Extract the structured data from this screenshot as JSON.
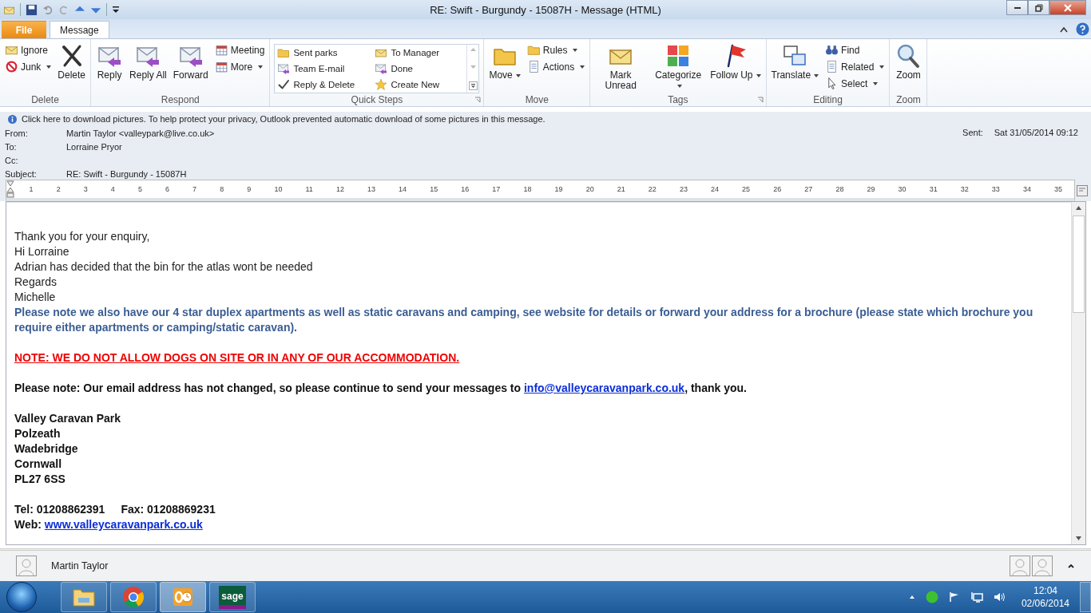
{
  "window": {
    "title": "RE: Swift - Burgundy - 15087H  -  Message (HTML)"
  },
  "tabs": [
    {
      "label": "File",
      "kind": "file",
      "selected": false
    },
    {
      "label": "Message",
      "kind": "tab",
      "selected": true
    }
  ],
  "ribbon": {
    "groups": [
      {
        "label": "Delete",
        "items": [
          {
            "kind": "column",
            "buttons": [
              {
                "label": "Ignore",
                "dropdown": false
              },
              {
                "label": "Junk",
                "dropdown": true
              }
            ]
          },
          {
            "kind": "large",
            "label": "Delete",
            "dropdown": false
          }
        ]
      },
      {
        "label": "Respond",
        "items": [
          {
            "kind": "large",
            "label": "Reply",
            "dropdown": false
          },
          {
            "kind": "large",
            "label": "Reply All",
            "dropdown": false
          },
          {
            "kind": "large",
            "label": "Forward",
            "dropdown": false
          },
          {
            "kind": "column",
            "buttons": [
              {
                "label": "Meeting",
                "dropdown": false
              },
              {
                "label": "More",
                "dropdown": true
              }
            ]
          }
        ]
      },
      {
        "label": "Quick Steps",
        "launcher": true,
        "items": [
          {
            "kind": "gallery",
            "buttons": [
              {
                "label": "Sent parks"
              },
              {
                "label": "To Manager"
              },
              {
                "label": "Team E-mail"
              },
              {
                "label": "Done"
              },
              {
                "label": "Reply & Delete"
              },
              {
                "label": "Create New"
              }
            ]
          }
        ]
      },
      {
        "label": "Move",
        "items": [
          {
            "kind": "large",
            "label": "Move",
            "dropdown": true
          },
          {
            "kind": "column",
            "buttons": [
              {
                "label": "Rules",
                "dropdown": true
              },
              {
                "label": "Actions",
                "dropdown": true
              }
            ]
          }
        ]
      },
      {
        "label": "Tags",
        "launcher": true,
        "items": [
          {
            "kind": "large",
            "label": "Mark Unread",
            "dropdown": false
          },
          {
            "kind": "large",
            "label": "Categorize",
            "dropdown": true
          },
          {
            "kind": "large",
            "label": "Follow Up",
            "dropdown": true
          }
        ]
      },
      {
        "label": "Editing",
        "items": [
          {
            "kind": "large",
            "label": "Translate",
            "dropdown": true
          },
          {
            "kind": "column",
            "buttons": [
              {
                "label": "Find",
                "dropdown": false
              },
              {
                "label": "Related",
                "dropdown": true
              },
              {
                "label": "Select",
                "dropdown": true
              }
            ]
          }
        ]
      },
      {
        "label": "Zoom",
        "items": [
          {
            "kind": "large",
            "label": "Zoom",
            "dropdown": false
          }
        ]
      }
    ]
  },
  "info_bar": {
    "text": "Click here to download pictures. To help protect your privacy, Outlook prevented automatic download of some pictures in this message."
  },
  "header": {
    "fields": [
      {
        "label": "From:",
        "value": "Martin Taylor <valleypark@live.co.uk>"
      },
      {
        "label": "To:",
        "value": "Lorraine Pryor"
      },
      {
        "label": "Cc:"
      },
      {
        "label": "Subject:",
        "value": "RE: Swift - Burgundy - 15087H"
      }
    ],
    "sent": {
      "label": "Sent:",
      "value": "Sat 31/05/2014 09:12"
    }
  },
  "ruler": {
    "marks": [
      "1",
      "2",
      "3",
      "4",
      "5",
      "6",
      "7",
      "8",
      "9",
      "10",
      "11",
      "12",
      "13",
      "14",
      "15",
      "16",
      "17",
      "18",
      "19",
      "20",
      "21",
      "22",
      "23",
      "24",
      "25",
      "26",
      "27",
      "28",
      "29",
      "30",
      "31",
      "32",
      "33",
      "34",
      "35"
    ]
  },
  "body": [
    {
      "kind": "plain",
      "parts": [
        {
          "kind": "text",
          "text": "Thank you for your enquiry,"
        }
      ]
    },
    {
      "kind": "plain",
      "parts": [
        {
          "kind": "text",
          "text": "Hi Lorraine"
        }
      ]
    },
    {
      "kind": "plain",
      "parts": [
        {
          "kind": "text",
          "text": "Adrian has decided that the bin for the atlas wont be needed"
        }
      ]
    },
    {
      "kind": "plain",
      "parts": [
        {
          "kind": "text",
          "text": "Regards"
        }
      ]
    },
    {
      "kind": "plain",
      "parts": [
        {
          "kind": "text",
          "text": "Michelle"
        }
      ]
    },
    {
      "kind": "notice",
      "parts": [
        {
          "kind": "text",
          "text": "Please note we also have our 4 star duplex apartments as well as static caravans and camping, see website for details or forward your address for a brochure (please state which brochure you require either apartments or camping/static caravan)."
        }
      ]
    },
    {
      "kind": "gap"
    },
    {
      "kind": "warning",
      "parts": [
        {
          "kind": "text",
          "text": "NOTE: WE DO NOT ALLOW DOGS ON SITE OR IN ANY OF OUR ACCOMMODATION."
        }
      ]
    },
    {
      "kind": "gap"
    },
    {
      "kind": "bold",
      "parts": [
        {
          "kind": "text",
          "text": "Please note: Our email address has not changed, so please continue to send your messages to "
        },
        {
          "kind": "link",
          "text": "info@valleycaravanpark.co.uk"
        },
        {
          "kind": "text",
          "text": ", thank you."
        }
      ]
    },
    {
      "kind": "gap"
    },
    {
      "kind": "bold",
      "parts": [
        {
          "kind": "text",
          "text": "Valley Caravan Park"
        }
      ]
    },
    {
      "kind": "bold",
      "parts": [
        {
          "kind": "text",
          "text": "Polzeath"
        }
      ]
    },
    {
      "kind": "bold",
      "parts": [
        {
          "kind": "text",
          "text": "Wadebridge"
        }
      ]
    },
    {
      "kind": "bold",
      "parts": [
        {
          "kind": "text",
          "text": "Cornwall"
        }
      ]
    },
    {
      "kind": "bold",
      "parts": [
        {
          "kind": "text",
          "text": "PL27 6SS"
        }
      ]
    },
    {
      "kind": "gap"
    },
    {
      "kind": "columns",
      "cells": [
        "Tel: 01208862391",
        "Fax: 01208869231"
      ]
    },
    {
      "kind": "bold",
      "parts": [
        {
          "kind": "text",
          "text": "Web: "
        },
        {
          "kind": "link",
          "text": "www.valleycaravanpark.co.uk"
        }
      ]
    }
  ],
  "people_pane": {
    "name": "Martin Taylor"
  },
  "taskbar": {
    "apps": [
      {
        "kind": "explorer",
        "selected": false
      },
      {
        "kind": "browser",
        "selected": false
      },
      {
        "kind": "outlook",
        "selected": true
      },
      {
        "kind": "sage",
        "label": "sage",
        "selected": false
      }
    ],
    "time": "12:04",
    "date": "02/06/2014"
  }
}
